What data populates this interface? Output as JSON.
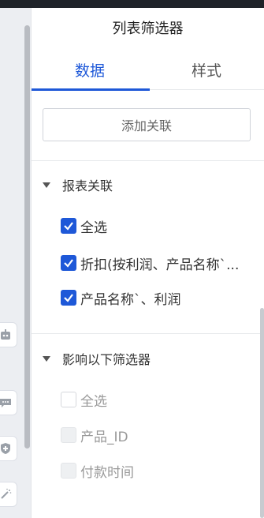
{
  "panel": {
    "title": "列表筛选器"
  },
  "tabs": [
    {
      "label": "数据",
      "active": true
    },
    {
      "label": "样式",
      "active": false
    }
  ],
  "association": {
    "add_button_label": "添加关联"
  },
  "report_link": {
    "title": "报表关联",
    "options": [
      {
        "label": "全选",
        "checked": true
      },
      {
        "label": "折扣(按利润、产品名称`...",
        "checked": true
      },
      {
        "label": "产品名称`、利润",
        "checked": true
      }
    ]
  },
  "affected_filters": {
    "title": "影响以下筛选器",
    "options": [
      {
        "label": "全选",
        "checked": false,
        "disabled": false
      },
      {
        "label": "产品_ID",
        "checked": false,
        "disabled": true
      },
      {
        "label": "付款时间",
        "checked": false,
        "disabled": true
      }
    ]
  },
  "colors": {
    "accent": "#1e58d8",
    "dark_bar": "#1f2329"
  },
  "icons": [
    "robot-icon",
    "chat-icon",
    "shield-plus-icon",
    "magic-wand-icon",
    "caret-down-icon",
    "check-icon"
  ]
}
